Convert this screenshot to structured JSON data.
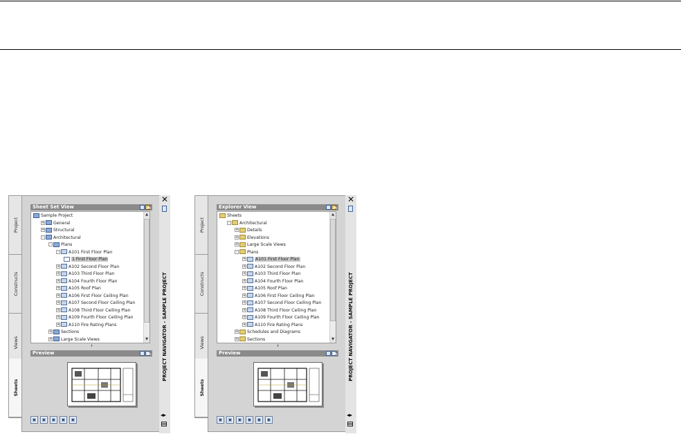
{
  "left": {
    "tabs": [
      "Project",
      "Constructs",
      "Views",
      "Sheets"
    ],
    "active_tab": 3,
    "tree_title": "Sheet Set View",
    "tree": [
      {
        "label": "Sample Project",
        "depth": 0,
        "exp": "",
        "icon": "sheetset"
      },
      {
        "label": "General",
        "depth": 1,
        "exp": "+",
        "icon": "sheetset"
      },
      {
        "label": "Structural",
        "depth": 1,
        "exp": "+",
        "icon": "sheetset"
      },
      {
        "label": "Architectural",
        "depth": 1,
        "exp": "-",
        "icon": "sheetset"
      },
      {
        "label": "Plans",
        "depth": 2,
        "exp": "-",
        "icon": "sheetset"
      },
      {
        "label": "A101 First Floor Plan",
        "depth": 3,
        "exp": "-",
        "icon": "sheet"
      },
      {
        "label": "1 First Floor Plan",
        "depth": 4,
        "exp": "",
        "icon": "view",
        "selected": true
      },
      {
        "label": "A102 Second Floor Plan",
        "depth": 3,
        "exp": "+",
        "icon": "sheet"
      },
      {
        "label": "A103 Third Floor Plan",
        "depth": 3,
        "exp": "+",
        "icon": "sheet"
      },
      {
        "label": "A104 Fourth Floor Plan",
        "depth": 3,
        "exp": "+",
        "icon": "sheet"
      },
      {
        "label": "A105 Roof Plan",
        "depth": 3,
        "exp": "+",
        "icon": "sheet"
      },
      {
        "label": "A106 First Floor Ceiling Plan",
        "depth": 3,
        "exp": "+",
        "icon": "sheet"
      },
      {
        "label": "A107 Second Floor Ceiling Plan",
        "depth": 3,
        "exp": "+",
        "icon": "sheet"
      },
      {
        "label": "A108 Third Floor Ceiling Plan",
        "depth": 3,
        "exp": "+",
        "icon": "sheet"
      },
      {
        "label": "A109 Fourth Floor Ceiling Plan",
        "depth": 3,
        "exp": "+",
        "icon": "sheet"
      },
      {
        "label": "A110 Fire Rating Plans",
        "depth": 3,
        "exp": "+",
        "icon": "sheet"
      },
      {
        "label": "Sections",
        "depth": 2,
        "exp": "+",
        "icon": "sheetset"
      },
      {
        "label": "Large Scale Views",
        "depth": 2,
        "exp": "+",
        "icon": "sheetset"
      }
    ],
    "preview_title": "Preview",
    "rail_title": "PROJECT NAVIGATOR - SAMPLE PROJECT",
    "toolbar_icons": [
      "new-sheet-icon",
      "new-subset-icon",
      "sheet-set-tools-icon",
      "sheet-list-icon",
      "publish-icon"
    ]
  },
  "right": {
    "tabs": [
      "Project",
      "Constructs",
      "Views",
      "Sheets"
    ],
    "active_tab": 3,
    "tree_title": "Explorer View",
    "tree": [
      {
        "label": "Sheets",
        "depth": 0,
        "exp": "",
        "icon": "folder"
      },
      {
        "label": "Architectural",
        "depth": 1,
        "exp": "-",
        "icon": "folder"
      },
      {
        "label": "Details",
        "depth": 2,
        "exp": "+",
        "icon": "folder"
      },
      {
        "label": "Elevations",
        "depth": 2,
        "exp": "+",
        "icon": "folder"
      },
      {
        "label": "Large Scale Views",
        "depth": 2,
        "exp": "+",
        "icon": "folder"
      },
      {
        "label": "Plans",
        "depth": 2,
        "exp": "-",
        "icon": "folder"
      },
      {
        "label": "A101 First Floor Plan",
        "depth": 3,
        "exp": "+",
        "icon": "sheet",
        "selected": true
      },
      {
        "label": "A102 Second Floor Plan",
        "depth": 3,
        "exp": "+",
        "icon": "sheet"
      },
      {
        "label": "A103 Third Floor Plan",
        "depth": 3,
        "exp": "+",
        "icon": "sheet"
      },
      {
        "label": "A104 Fourth Floor Plan",
        "depth": 3,
        "exp": "+",
        "icon": "sheet"
      },
      {
        "label": "A105 Roof Plan",
        "depth": 3,
        "exp": "+",
        "icon": "sheet"
      },
      {
        "label": "A106 First Floor Ceiling Plan",
        "depth": 3,
        "exp": "+",
        "icon": "sheet"
      },
      {
        "label": "A107 Second Floor Ceiling Plan",
        "depth": 3,
        "exp": "+",
        "icon": "sheet"
      },
      {
        "label": "A108 Third Floor Ceiling Plan",
        "depth": 3,
        "exp": "+",
        "icon": "sheet"
      },
      {
        "label": "A109 Fourth Floor Ceiling Plan",
        "depth": 3,
        "exp": "+",
        "icon": "sheet"
      },
      {
        "label": "A110 Fire Rating Plans",
        "depth": 3,
        "exp": "+",
        "icon": "sheet"
      },
      {
        "label": "Schedules and Diagrams",
        "depth": 2,
        "exp": "+",
        "icon": "folder"
      },
      {
        "label": "Sections",
        "depth": 2,
        "exp": "+",
        "icon": "folder"
      }
    ],
    "preview_title": "Preview",
    "rail_title": "PROJECT NAVIGATOR - SAMPLE PROJECT",
    "toolbar_icons": [
      "add-view-icon",
      "regenerate-icon",
      "sheet-set-tools-icon",
      "sheet-list-icon",
      "publish-icon",
      "repath-icon"
    ]
  }
}
